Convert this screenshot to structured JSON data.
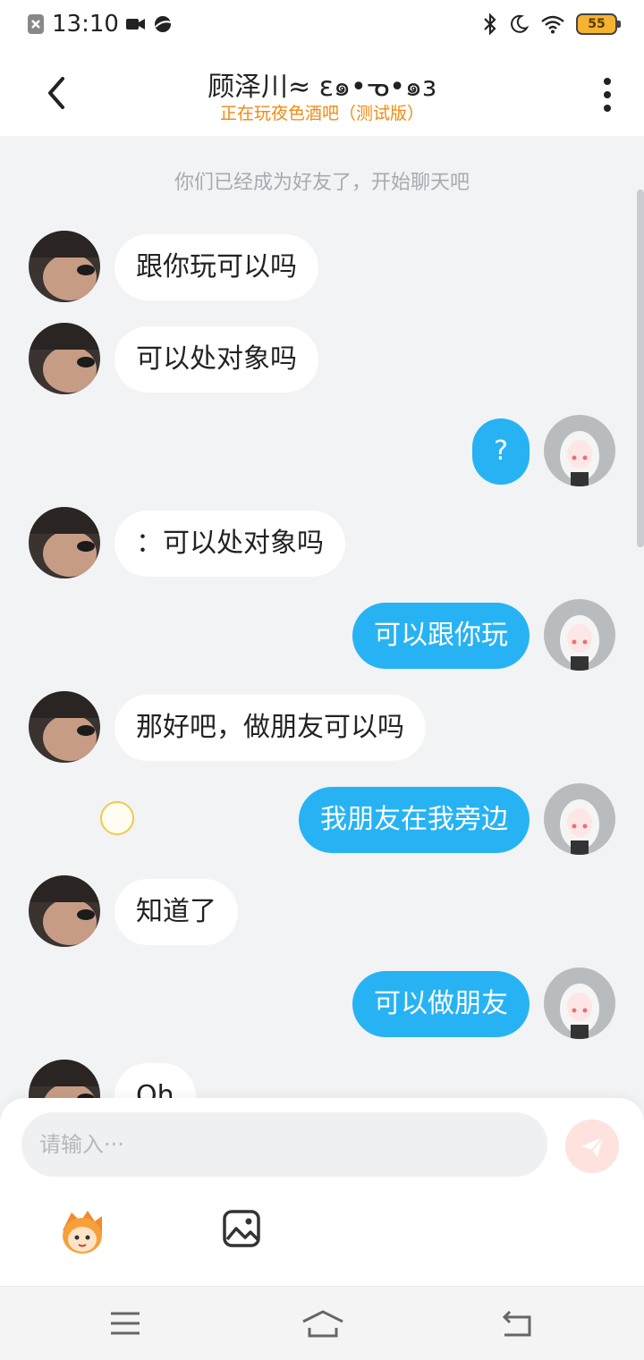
{
  "status_bar": {
    "time": "13:10",
    "battery": "55",
    "icons": [
      "notification-blocked-icon",
      "video-icon",
      "planet-icon",
      "bluetooth-icon",
      "moon-icon",
      "wifi-icon",
      "battery-icon"
    ]
  },
  "header": {
    "title": "顾泽川≈  ɛ๑•ᓀ•๑ɜ",
    "subtitle": "正在玩夜色酒吧（测试版）",
    "back_icon": "chevron-left-icon",
    "more_icon": "more-vertical-icon"
  },
  "chat": {
    "system_message": "你们已经成为好友了，开始聊天吧",
    "messages": [
      {
        "side": "left",
        "text": "跟你玩可以吗"
      },
      {
        "side": "left",
        "text": "可以处对象吗"
      },
      {
        "side": "right",
        "text": "?"
      },
      {
        "side": "left",
        "text": "：可以处对象吗"
      },
      {
        "side": "right",
        "text": "可以跟你玩"
      },
      {
        "side": "left",
        "text": "那好吧，做朋友可以吗"
      },
      {
        "side": "right",
        "text": "我朋友在我旁边"
      },
      {
        "side": "left",
        "text": "知道了"
      },
      {
        "side": "right",
        "text": "可以做朋友"
      },
      {
        "side": "left",
        "text": "Oh"
      }
    ]
  },
  "composer": {
    "placeholder": "请输入···",
    "send_icon": "send-icon",
    "emoji_icon": "mascot-icon",
    "image_icon": "image-icon"
  },
  "colors": {
    "accent_blue": "#27b3f3",
    "subtitle_orange": "#f08a12",
    "background": "#f1f3f5"
  }
}
